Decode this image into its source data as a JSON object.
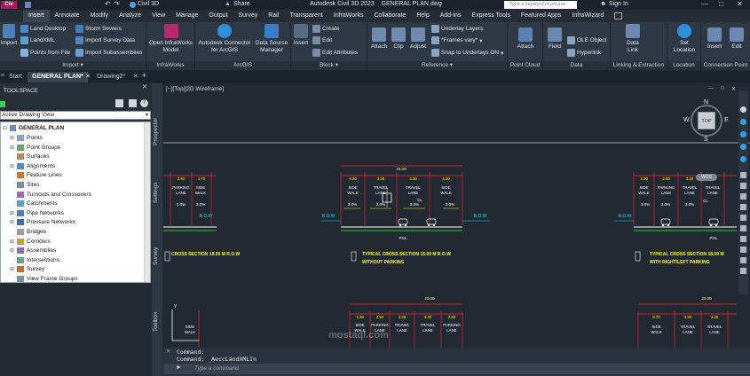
{
  "titlebar": {
    "app_short": "Civ",
    "share_label": "Share",
    "workspace": "Civil 3D",
    "title": "Autodesk Civil 3D 2023    GENERAL PLAN.dwg",
    "search_placeholder": "Type a keyword or phrase",
    "signin_label": "Sign In"
  },
  "menu": {
    "tabs": [
      "Insert",
      "Annotate",
      "Modify",
      "Analyze",
      "View",
      "Manage",
      "Output",
      "Survey",
      "Rail",
      "Transparent",
      "InfraWorks",
      "Collaborate",
      "Help",
      "Add-ins",
      "Express Tools",
      "Featured Apps",
      "InfraWizard"
    ],
    "active_index": 0
  },
  "ribbon": {
    "import_panel": {
      "title": "Import",
      "big": "Import",
      "items": [
        "Land Desktop",
        "LandXML",
        "Points from File",
        "Storm Sewers",
        "Import Survey Data",
        "Import Subassemblies"
      ]
    },
    "infraworks_panel": {
      "title": "InfraWorks",
      "big": "Open InfraWorks Model"
    },
    "arcgis_panel": {
      "title": "ArcGIS",
      "big1": "Autodesk Connector for ArcGIS",
      "big2": "Data Source Manager"
    },
    "block_panel": {
      "title": "Block",
      "big": "Insert",
      "items": [
        "Create",
        "Edit",
        "Edit Attributes"
      ]
    },
    "reference_panel": {
      "title": "Reference",
      "bigs": [
        "Attach",
        "Clip",
        "Adjust"
      ],
      "items": [
        "Underlay Layers",
        "*Frames vary*",
        "Snap to Underlays ON"
      ]
    },
    "pointcloud_panel": {
      "title": "Point Cloud",
      "big": "Attach"
    },
    "data_panel": {
      "title": "Data",
      "big": "Field",
      "items": [
        "OLE Object",
        "Hyperlink"
      ]
    },
    "linking_panel": {
      "title": "Linking & Extraction",
      "big": "Data Link"
    },
    "location_panel": {
      "title": "Location",
      "big": "Set Location"
    },
    "connection_panel": {
      "title": "Connection Point",
      "bigs": [
        "Insert",
        "Edit"
      ]
    }
  },
  "doctabs": {
    "start": "Start",
    "tabs": [
      "GENERAL PLAN*",
      "Drawing2*"
    ],
    "add": "+"
  },
  "toolspace": {
    "title": "TOOLSPACE",
    "view_select": "Active Drawing View",
    "root": "GENERAL PLAN",
    "items": [
      "Points",
      "Point Groups",
      "Surfaces",
      "Alignments",
      "Feature Lines",
      "Sites",
      "Turnouts and Crossovers",
      "Catchments",
      "Pipe Networks",
      "Pressure Networks",
      "Bridges",
      "Corridors",
      "Assemblies",
      "Intersections",
      "Survey",
      "View Frame Groups"
    ],
    "side_tabs": [
      "Prospector",
      "Settings",
      "Survey",
      "Toolbox"
    ]
  },
  "viewport": {
    "label": "[−][Top][2D Wireframe]",
    "viewcube": {
      "top": "TOP",
      "n": "N",
      "s": "S",
      "w": "W",
      "e": "E",
      "wcs": "WCS"
    }
  },
  "drawing": {
    "section1": {
      "title": "TYPICAL CROSS SECTION 15.00 M R.O.W",
      "subtitle": "WITHOUT PARKING",
      "total": "15.00",
      "dims": [
        "4.20",
        "3.30",
        "3.30",
        "4.20"
      ],
      "lanes": [
        "SIDE WALK",
        "TRAVEL LANE",
        "TRAVEL LANE",
        "SIDE WALK"
      ],
      "slope": "3.0%",
      "row": "R.O.W"
    },
    "section2": {
      "title": "TYPICAL CROSS SECTION 18.00 M",
      "subtitle": "WITH RIGHT/LEFT PARKING",
      "dims": [
        "3.20",
        "2.50",
        "3.30",
        "3.30"
      ],
      "lanes": [
        "SIDE WALK",
        "PARKING LANE",
        "TRAVEL LANE",
        "TRAVEL LANE"
      ],
      "slope": "3.0%",
      "row": "R.O.W"
    },
    "section0": {
      "title": "CROSS SECTION 18.00 M R.O.W",
      "dims": [
        "2.50",
        "1.70"
      ],
      "lanes": [
        "PARKING LANE",
        "SIDE WALK"
      ],
      "slope": "2.0%",
      "slope2": "3.0%",
      "row": "R.O.W"
    },
    "section3": {
      "total": "20.00",
      "dims": [
        "4.20",
        "2.50",
        "3.30",
        "3.30",
        "2.50"
      ],
      "lanes": [
        "SIDE WALK",
        "PARKING LANE",
        "TRAVEL LANE",
        "TRAVEL LANE",
        "PARKING LANE"
      ]
    },
    "section4": {
      "total": "20.00",
      "dims": [
        "6.70",
        "3.30",
        "3.30"
      ],
      "lanes": [
        "SIDE WALK",
        "TRAVEL LANE",
        "TRAVEL LANE"
      ]
    },
    "section5": {
      "lanes": [
        "SIDE WALK"
      ]
    },
    "pgl": "PGL",
    "cl": "CL"
  },
  "command": {
    "history": [
      "Command:",
      "Command:  _AeccLandXMLIn"
    ],
    "placeholder": "Type a command"
  },
  "watermark": "mostaql.com",
  "colors": {
    "yellow": "#ffff00",
    "red": "#ff2a2a",
    "cyan": "#00e5ff",
    "green": "#3cff3c",
    "white": "#ffffff"
  }
}
